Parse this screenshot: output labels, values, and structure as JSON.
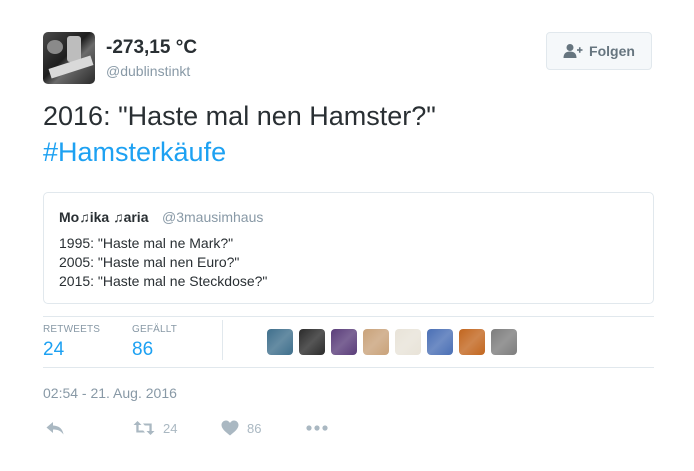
{
  "author": {
    "display_name": "-273,15 °C",
    "screen_name": "@dublinstinkt",
    "avatar_icon": "avatar-image"
  },
  "follow_button": {
    "label": "Folgen",
    "icon": "add-user-icon"
  },
  "tweet": {
    "line1": "2016: \"Haste mal nen Hamster?\"",
    "hashtag": "#Hamsterkäufe"
  },
  "quote": {
    "name": "Mo♫ika ♫aria",
    "handle": "@3mausimhaus",
    "lines": [
      "1995: \"Haste mal ne Mark?\"",
      "2005: \"Haste mal nen Euro?\"",
      "2015: \"Haste mal ne Steckdose?\""
    ]
  },
  "stats": {
    "retweets_label": "RETWEETS",
    "retweets_value": "24",
    "likes_label": "GEFÄLLT",
    "likes_value": "86"
  },
  "likers": [
    {
      "icon": "user-avatar-1",
      "color": "#3f6f8c"
    },
    {
      "icon": "user-avatar-2",
      "color": "#2b2b2b"
    },
    {
      "icon": "user-avatar-3",
      "color": "#5a3d7a"
    },
    {
      "icon": "user-avatar-4",
      "color": "#c9a27a"
    },
    {
      "icon": "user-avatar-5",
      "color": "#e8e3d8"
    },
    {
      "icon": "user-avatar-6",
      "color": "#4a6fb5"
    },
    {
      "icon": "user-avatar-7",
      "color": "#c2661f"
    },
    {
      "icon": "user-avatar-8",
      "color": "#7d7d7d"
    }
  ],
  "timestamp": "02:54 - 21. Aug. 2016",
  "actions": {
    "reply_icon": "reply-icon",
    "retweet_icon": "retweet-icon",
    "retweet_count": "24",
    "like_icon": "heart-icon",
    "like_count": "86",
    "more_icon": "more-icon"
  },
  "colors": {
    "link": "#1da1f2",
    "text": "#292f33",
    "muted": "#8899a6",
    "border": "#e1e8ed",
    "action_gray": "#aab8c2"
  }
}
